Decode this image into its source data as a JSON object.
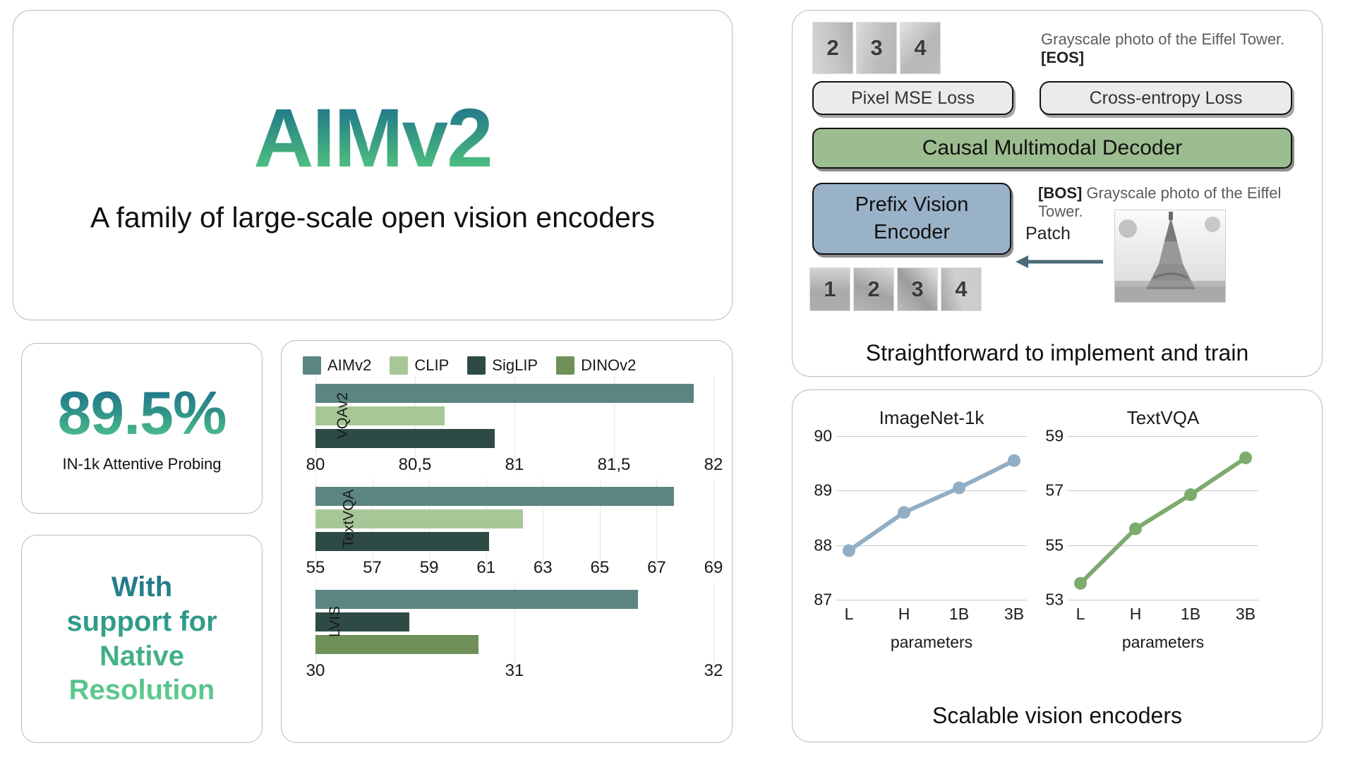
{
  "hero": {
    "title": "AIMv2",
    "subtitle": "A family of large-scale open vision encoders",
    "gradient_from": "#1d6f8e",
    "gradient_to": "#55cf8c"
  },
  "stat": {
    "value": "89.5%",
    "label": "IN-1k Attentive Probing"
  },
  "native": {
    "line1": "With",
    "line2": "support for",
    "line3": "Native",
    "line4": "Resolution"
  },
  "bar_legend": [
    {
      "label": "AIMv2",
      "color": "#5b8580"
    },
    {
      "label": "CLIP",
      "color": "#a8c796"
    },
    {
      "label": "SigLIP",
      "color": "#2e4a45"
    },
    {
      "label": "DINOv2",
      "color": "#6f9058"
    }
  ],
  "diagram": {
    "top_patches": [
      "2",
      "3",
      "4"
    ],
    "bottom_patches": [
      "1",
      "2",
      "3",
      "4"
    ],
    "pixel_loss_label": "Pixel MSE Loss",
    "cross_entropy_label": "Cross-entropy Loss",
    "decoder_label": "Causal Multimodal Decoder",
    "encoder_line1": "Prefix Vision",
    "encoder_line2": "Encoder",
    "eos_caption_text": "Grayscale photo of the Eiffel Tower. ",
    "eos_token": "[EOS]",
    "bos_token": "[BOS]",
    "bos_caption_text": " Grayscale photo of the Eiffel Tower.",
    "patch_arrow_label": "Patch",
    "caption": "Straightforward to implement and train"
  },
  "lines": {
    "caption": "Scalable vision encoders"
  },
  "chart_data": [
    {
      "type": "bar",
      "title": "",
      "orientation": "horizontal",
      "groups": [
        {
          "name": "VQAv2",
          "xlim": [
            80,
            82
          ],
          "ticks": [
            "80",
            "80,5",
            "81",
            "81,5",
            "82"
          ],
          "tick_values": [
            80,
            80.5,
            81,
            81.5,
            82
          ],
          "bars": [
            {
              "series": "AIMv2",
              "value": 81.9,
              "color": "#5b8580"
            },
            {
              "series": "CLIP",
              "value": 80.65,
              "color": "#a8c796"
            },
            {
              "series": "SigLIP",
              "value": 80.9,
              "color": "#2e4a45"
            }
          ]
        },
        {
          "name": "TextVQA",
          "xlim": [
            55,
            69
          ],
          "ticks": [
            "55",
            "57",
            "59",
            "61",
            "63",
            "65",
            "67",
            "69"
          ],
          "tick_values": [
            55,
            57,
            59,
            61,
            63,
            65,
            67,
            69
          ],
          "bars": [
            {
              "series": "AIMv2",
              "value": 67.6,
              "color": "#5b8580"
            },
            {
              "series": "CLIP",
              "value": 62.3,
              "color": "#a8c796"
            },
            {
              "series": "SigLIP",
              "value": 61.1,
              "color": "#2e4a45"
            }
          ]
        },
        {
          "name": "LVIS",
          "xlim": [
            30,
            32
          ],
          "ticks": [
            "30",
            "31",
            "32"
          ],
          "tick_values": [
            30,
            31,
            32
          ],
          "bars": [
            {
              "series": "AIMv2",
              "value": 31.62,
              "color": "#5b8580"
            },
            {
              "series": "SigLIP",
              "value": 30.47,
              "color": "#2e4a45"
            },
            {
              "series": "DINOv2",
              "value": 30.82,
              "color": "#6f9058"
            }
          ]
        }
      ]
    },
    {
      "type": "line",
      "title": "ImageNet-1k",
      "xlabel": "parameters",
      "ylabel": "",
      "x": [
        "L",
        "H",
        "1B",
        "3B"
      ],
      "y": [
        87.9,
        88.6,
        89.05,
        89.55
      ],
      "ylim": [
        87,
        90
      ],
      "yticks": [
        "87",
        "88",
        "89",
        "90"
      ],
      "ytick_values": [
        87,
        88,
        89,
        90
      ],
      "color": "#92aec4",
      "grid": true,
      "legend": "none"
    },
    {
      "type": "line",
      "title": "TextVQA",
      "xlabel": "parameters",
      "ylabel": "",
      "x": [
        "L",
        "H",
        "1B",
        "3B"
      ],
      "y": [
        53.6,
        55.6,
        56.85,
        58.2
      ],
      "ylim": [
        53,
        59
      ],
      "yticks": [
        "53",
        "55",
        "57",
        "59"
      ],
      "ytick_values": [
        53,
        55,
        57,
        59
      ],
      "color": "#7dab6c",
      "grid": true,
      "legend": "none"
    }
  ]
}
